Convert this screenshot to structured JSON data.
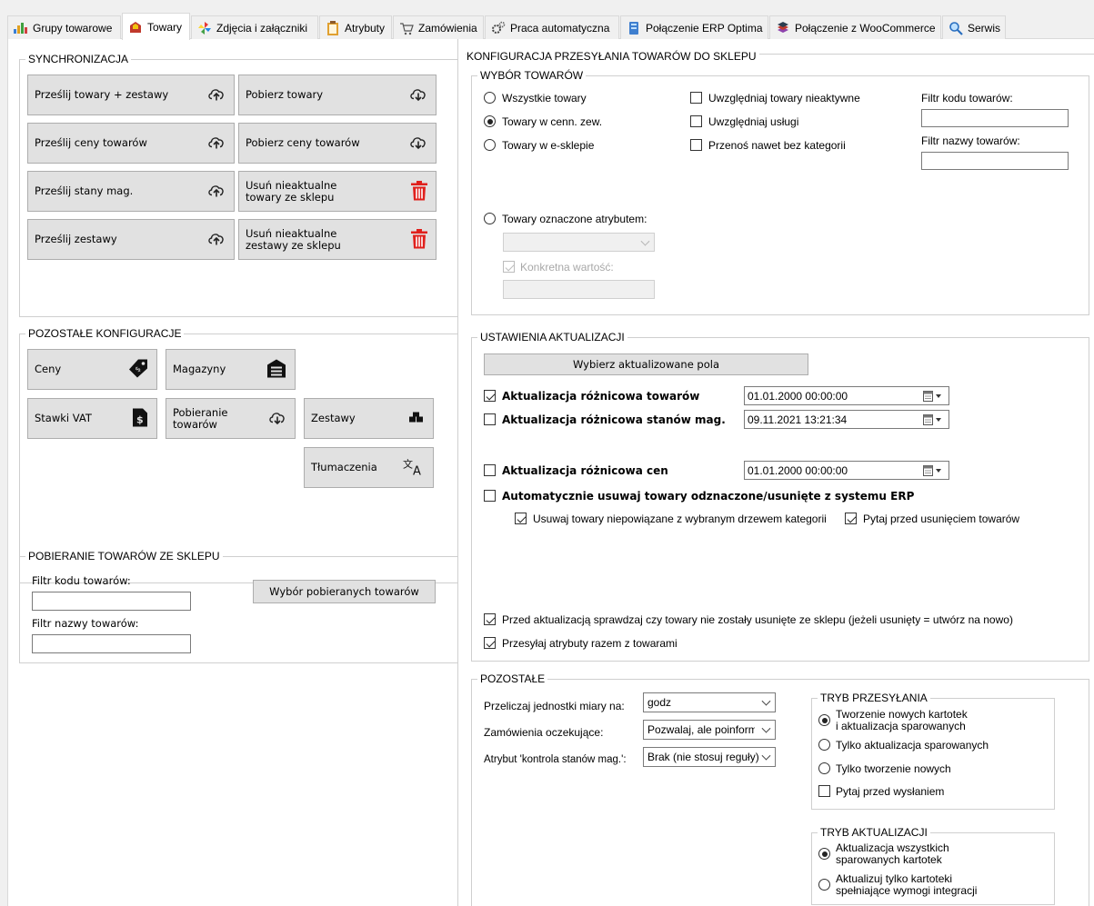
{
  "tabs": [
    {
      "label": "Grupy towarowe",
      "icon": "bar-chart-icon"
    },
    {
      "label": "Towary",
      "icon": "goods-icon",
      "active": true
    },
    {
      "label": "Zdjęcia i załączniki",
      "icon": "pinwheel-icon"
    },
    {
      "label": "Atrybuty",
      "icon": "clipboard-icon"
    },
    {
      "label": "Zamówienia",
      "icon": "cart-icon"
    },
    {
      "label": "Praca automatyczna",
      "icon": "gears-icon"
    },
    {
      "label": "Połączenie ERP Optima",
      "icon": "database-icon"
    },
    {
      "label": "Połączenie z WooCommerce",
      "icon": "stack-icon"
    },
    {
      "label": "Serwis",
      "icon": "magnifier-icon"
    }
  ],
  "sync": {
    "title": "SYNCHRONIZACJA",
    "send_goods": "Prześlij towary + zestawy",
    "get_goods": "Pobierz towary",
    "send_prices": "Prześlij ceny towarów",
    "get_prices": "Pobierz ceny towarów",
    "send_stock": "Prześlij stany mag.",
    "del_goods_l1": "Usuń nieaktualne",
    "del_goods_l2": "towary ze sklepu",
    "send_sets": "Prześlij zestawy",
    "del_sets_l1": "Usuń nieaktualne",
    "del_sets_l2": "zestawy ze sklepu"
  },
  "other_config": {
    "title": "POZOSTAŁE KONFIGURACJE",
    "prices": "Ceny",
    "warehouses": "Magazyny",
    "vat": "Stawki VAT",
    "download_l1": "Pobieranie",
    "download_l2": "towarów",
    "sets": "Zestawy",
    "translations": "Tłumaczenia"
  },
  "shop_download": {
    "title": "POBIERANIE TOWARÓW ZE SKLEPU",
    "code_filter": "Filtr kodu towarów:",
    "name_filter": "Filtr nazwy towarów:",
    "select_button": "Wybór pobieranych towarów"
  },
  "config": {
    "title": "KONFIGURACJA PRZESYŁANIA TOWARÓW DO SKLEPU",
    "selection_title": "WYBÓR TOWARÓW",
    "all_goods": "Wszystkie towary",
    "external_price": "Towary w cenn. zew.",
    "eshop_goods": "Towary w e-sklepie",
    "include_inactive": "Uwzględniaj towary nieaktywne",
    "include_services": "Uwzględniaj usługi",
    "no_category": "Przenoś nawet bez kategorii",
    "code_filter": "Filtr kodu towarów:",
    "name_filter": "Filtr nazwy towarów:",
    "attr_goods": "Towary oznaczone atrybutem:",
    "specific_value": "Konkretna wartość:"
  },
  "update": {
    "title": "USTAWIENIA AKTUALIZACJI",
    "choose_fields": "Wybierz aktualizowane pola",
    "diff_goods": "Aktualizacja różnicowa towarów",
    "diff_goods_date": "01.01.2000 00:00:00",
    "diff_stock": "Aktualizacja różnicowa stanów mag.",
    "diff_stock_date": "09.11.2021 13:21:34",
    "diff_prices": "Aktualizacja różnicowa cen",
    "diff_prices_date": "01.01.2000 00:00:00",
    "auto_delete": "Automatycznie usuwaj towary odznaczone/usunięte z systemu ERP",
    "delete_unlinked": "Usuwaj towary niepowiązane z wybranym drzewem kategorii",
    "ask_before_delete": "Pytaj przed usunięciem towarów",
    "check_deleted": "Przed aktualizacją sprawdzaj czy towary nie zostały usunięte ze sklepu (jeżeli usunięty = utwórz na nowo)",
    "send_attributes": "Przesyłaj atrybuty razem z towarami"
  },
  "remaining": {
    "title": "POZOSTAŁE",
    "units_label": "Przeliczaj jednostki miary na:",
    "units_value": "godz",
    "orders_label": "Zamówienia oczekujące:",
    "orders_value": "Pozwalaj, ale poinformuj",
    "stock_attr_label": "Atrybut 'kontrola stanów mag.':",
    "stock_attr_value": "Brak (nie stosuj reguły)"
  },
  "send_mode": {
    "title": "TRYB PRZESYŁANIA",
    "opt1_l1": "Tworzenie nowych kartotek",
    "opt1_l2": "i aktualizacja sparowanych",
    "opt2": "Tylko aktualizacja sparowanych",
    "opt3": "Tylko tworzenie nowych",
    "ask_before_send": "Pytaj przed wysłaniem"
  },
  "update_mode": {
    "title": "TRYB AKTUALIZACJI",
    "opt1_l1": "Aktualizacja wszystkich",
    "opt1_l2": "sparowanych kartotek",
    "opt2_l1": "Aktualizuj tylko kartoteki",
    "opt2_l2": "spełniające wymogi integracji"
  },
  "colors": {
    "trash": "#e0201c",
    "tab_border": "#d9d9d9",
    "button": "#e1e1e1"
  }
}
